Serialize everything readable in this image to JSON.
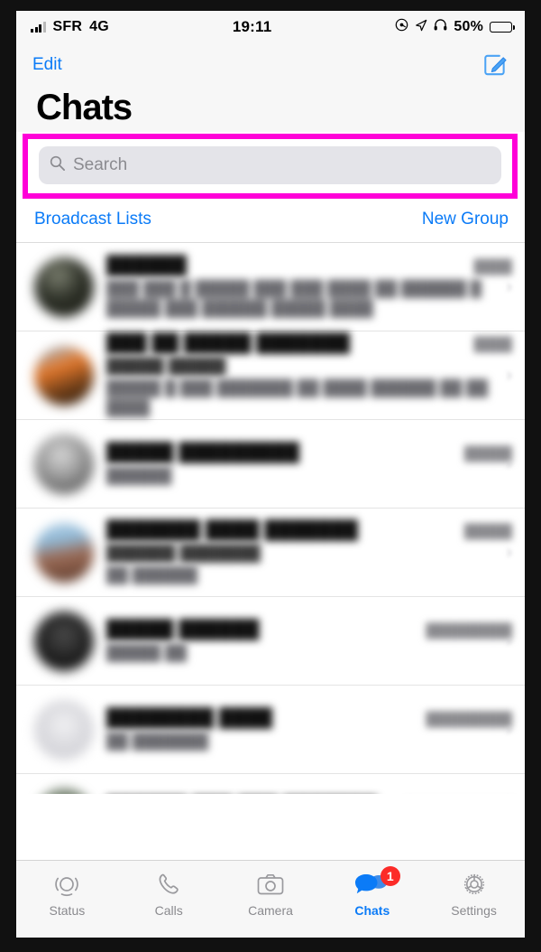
{
  "status_bar": {
    "carrier": "SFR",
    "network": "4G",
    "time": "19:11",
    "battery_percent": "50%",
    "battery_level": 50,
    "icons": [
      "signal-bars-icon",
      "alarm-icon",
      "location-arrow-icon",
      "headphones-icon",
      "battery-icon"
    ]
  },
  "nav": {
    "edit_label": "Edit",
    "compose_icon": "compose-icon",
    "title": "Chats"
  },
  "search": {
    "placeholder": "Search",
    "value": "",
    "icon": "search-icon",
    "highlight_color": "#ff00d8",
    "field_background": "#e4e4e9"
  },
  "links": {
    "broadcast_label": "Broadcast Lists",
    "new_group_label": "New Group",
    "link_color": "#0b7bf7"
  },
  "chat_list": {
    "redacted": true,
    "rows": [
      {
        "title": "██████",
        "sender": "",
        "preview": "███ ███ █ █████ ███ ███ ████ ██ ██████ █ █████ ███ ██████ █████ ████",
        "time": "████"
      },
      {
        "title": "███ ██ █████ ███████",
        "sender": "█████ █████",
        "preview": "█████ █ ███ ███████ ██ ████ ██████ ██ ██ ████",
        "time": "████"
      },
      {
        "title": "█████ █████████",
        "sender": "",
        "preview": "██████",
        "time": "█████"
      },
      {
        "title": "███████ ████ ███████",
        "sender": "██████ ███████",
        "preview": "██ ██████",
        "time": "█████"
      },
      {
        "title": "█████ ██████",
        "sender": "",
        "preview": "█████ ██",
        "time": "█████████"
      },
      {
        "title": "████████ ████",
        "sender": "",
        "preview": "██ ███████",
        "time": "█████████"
      },
      {
        "title": "██████ ███ ███ ███████…",
        "sender": "█████ █████████",
        "preview": "",
        "time": "███████████"
      }
    ]
  },
  "tab_bar": {
    "active": "Chats",
    "active_color": "#0b7bf7",
    "inactive_color": "#8a8a8e",
    "badge_color": "#fc2b28",
    "items": [
      {
        "label": "Status",
        "icon": "status-rings-icon",
        "badge": ""
      },
      {
        "label": "Calls",
        "icon": "phone-icon",
        "badge": ""
      },
      {
        "label": "Camera",
        "icon": "camera-icon",
        "badge": ""
      },
      {
        "label": "Chats",
        "icon": "chat-bubbles-icon",
        "badge": "1"
      },
      {
        "label": "Settings",
        "icon": "gear-icon",
        "badge": ""
      }
    ]
  }
}
